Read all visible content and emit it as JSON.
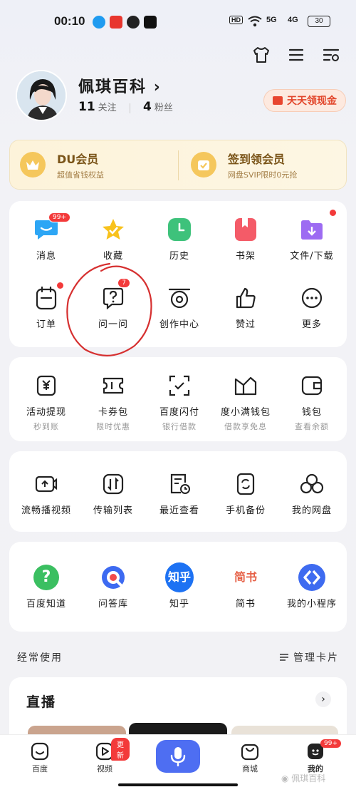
{
  "status_bar": {
    "time": "00:10",
    "right_labels": [
      "5G",
      "4G"
    ],
    "battery": "30"
  },
  "profile": {
    "name": "佩琪百科",
    "following_count": "11",
    "following_label": "关注",
    "fans_count": "4",
    "fans_label": "粉丝"
  },
  "cash_button": "天天领现金",
  "vip": {
    "left_title": "DU会员",
    "left_sub": "超值省钱权益",
    "right_title": "签到领会员",
    "right_sub": "网盘SVIP限时0元抢"
  },
  "grid1": [
    {
      "label": "消息",
      "icon": "message-icon",
      "badge": "99+"
    },
    {
      "label": "收藏",
      "icon": "star-icon"
    },
    {
      "label": "历史",
      "icon": "clock-icon"
    },
    {
      "label": "书架",
      "icon": "bookmark-icon"
    },
    {
      "label": "文件/下载",
      "icon": "download-icon"
    },
    {
      "label": "订单",
      "icon": "order-icon"
    },
    {
      "label": "问一问",
      "icon": "question-icon",
      "badge": "7"
    },
    {
      "label": "创作中心",
      "icon": "creator-icon"
    },
    {
      "label": "赞过",
      "icon": "thumb-icon"
    },
    {
      "label": "更多",
      "icon": "more-icon"
    }
  ],
  "grid2": [
    {
      "label": "活动提现",
      "sub": "秒到账"
    },
    {
      "label": "卡券包",
      "sub": "限时优惠"
    },
    {
      "label": "百度闪付",
      "sub": "银行借款"
    },
    {
      "label": "度小满钱包",
      "sub": "借款享免息"
    },
    {
      "label": "钱包",
      "sub": "查看余额"
    }
  ],
  "grid3": [
    {
      "label": "流畅播视频"
    },
    {
      "label": "传输列表"
    },
    {
      "label": "最近查看"
    },
    {
      "label": "手机备份"
    },
    {
      "label": "我的网盘"
    }
  ],
  "grid4": [
    {
      "label": "百度知道",
      "icon_text": "?"
    },
    {
      "label": "问答库",
      "icon_text": ""
    },
    {
      "label": "知乎",
      "icon_text": "知乎"
    },
    {
      "label": "简书",
      "icon_text": "简书"
    },
    {
      "label": "我的小程序",
      "icon_text": ""
    }
  ],
  "frequent": {
    "title": "经常使用",
    "manage": "管理卡片"
  },
  "live": {
    "title": "直播"
  },
  "tabbar": [
    {
      "label": "百度"
    },
    {
      "label": "视频",
      "badge": "更新"
    },
    {
      "label": ""
    },
    {
      "label": "商城"
    },
    {
      "label": "我的",
      "badge": "99+"
    }
  ],
  "watermark": "佩琪百科",
  "colors": {
    "accent": "#4e6ef2",
    "badge_red": "#f33a3a",
    "vip_gold": "#7a5418"
  }
}
